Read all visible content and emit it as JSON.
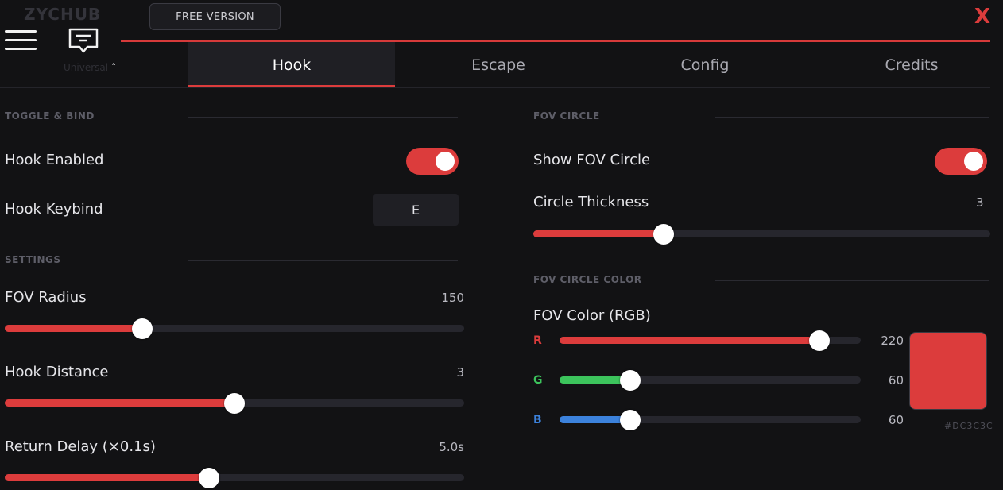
{
  "app": {
    "logo_text": "ZYCHUB",
    "logo_sub": "Universal",
    "free_version_label": "FREE VERSION",
    "close_label": "X"
  },
  "tabs": [
    {
      "label": "Hook",
      "active": true
    },
    {
      "label": "Escape",
      "active": false
    },
    {
      "label": "Config",
      "active": false
    },
    {
      "label": "Credits",
      "active": false
    }
  ],
  "left": {
    "toggle_bind": {
      "title": "TOGGLE & BIND",
      "hook_enabled": {
        "label": "Hook Enabled",
        "on": true
      },
      "hook_keybind": {
        "label": "Hook Keybind",
        "key": "E"
      }
    },
    "settings": {
      "title": "SETTINGS",
      "sliders": [
        {
          "label": "FOV Radius",
          "value_text": "150",
          "fraction": 0.3
        },
        {
          "label": "Hook Distance",
          "value_text": "3",
          "fraction": 0.5
        },
        {
          "label": "Return Delay (×0.1s)",
          "value_text": "5.0s",
          "fraction": 0.445
        }
      ]
    }
  },
  "right": {
    "fov_circle": {
      "title": "FOV CIRCLE",
      "show_fov_circle": {
        "label": "Show FOV Circle",
        "on": true
      },
      "circle_thickness": {
        "label": "Circle Thickness",
        "value_text": "3",
        "fraction": 0.286
      }
    },
    "fov_circle_color": {
      "title": "FOV CIRCLE COLOR",
      "label": "FOV Color (RGB)",
      "channels": [
        {
          "label": "R",
          "value": 220,
          "value_text": "220",
          "fraction": 0.863,
          "color": "#dc3c3c"
        },
        {
          "label": "G",
          "value": 60,
          "value_text": "60",
          "fraction": 0.235,
          "color": "#3cc45c"
        },
        {
          "label": "B",
          "value": 60,
          "value_text": "60",
          "fraction": 0.235,
          "color": "#3c82dc"
        }
      ],
      "swatch_color": "#dc3c3c",
      "hex_text": "#DC3C3C"
    }
  },
  "colors": {
    "accent": "#dc3c3c"
  }
}
